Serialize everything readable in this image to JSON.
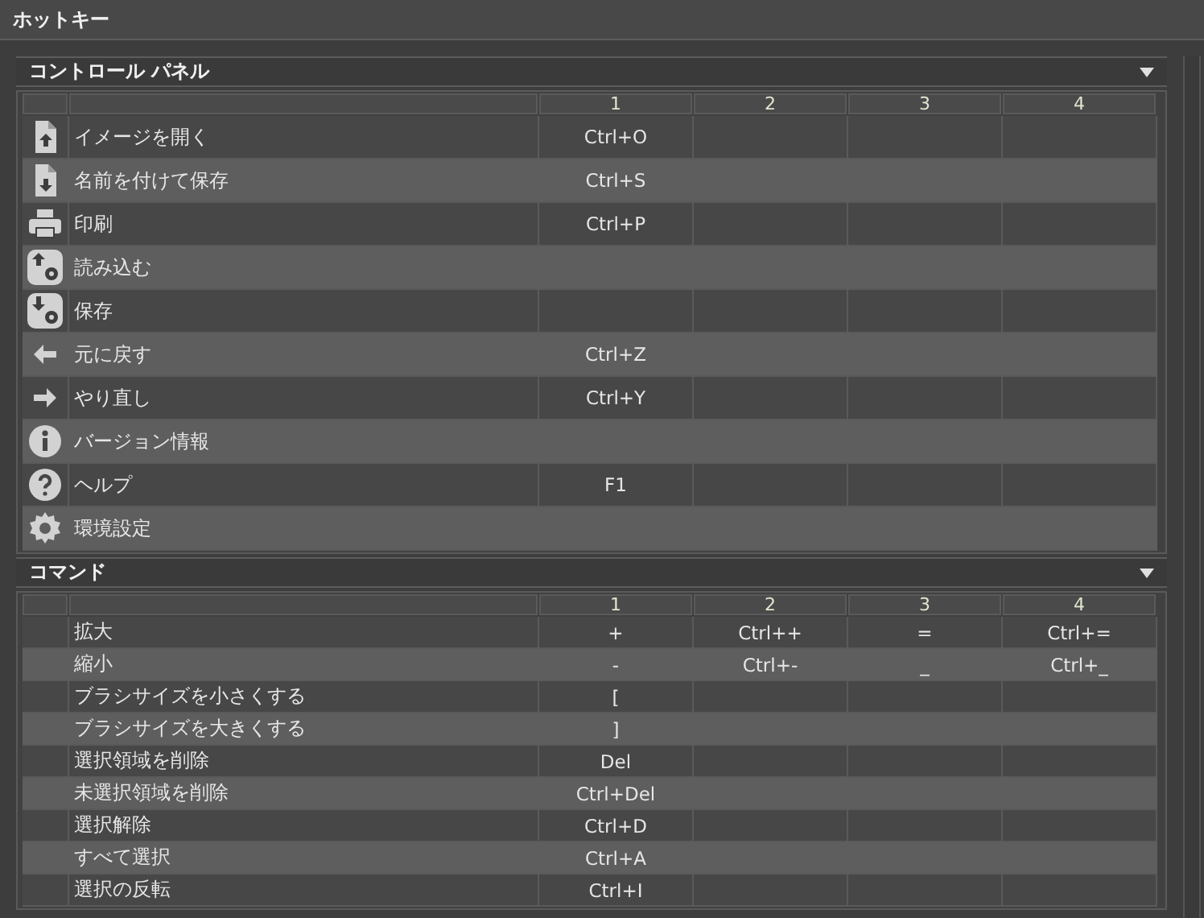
{
  "window": {
    "title": "ホットキー"
  },
  "sections": [
    {
      "title": "コントロール パネル",
      "expanded": true,
      "columns": [
        "1",
        "2",
        "3",
        "4"
      ],
      "rows": [
        {
          "kind": "file-up",
          "name": "イメージを開く",
          "keys": [
            "Ctrl+O"
          ]
        },
        {
          "kind": "file-down",
          "name": "名前を付けて保存",
          "keys": [
            "Ctrl+S"
          ]
        },
        {
          "kind": "printer",
          "name": "印刷",
          "keys": [
            "Ctrl+P"
          ]
        },
        {
          "kind": "up-gear",
          "name": "読み込む",
          "keys": []
        },
        {
          "kind": "down-gear",
          "name": "保存",
          "keys": []
        },
        {
          "kind": "arrow-left",
          "name": "元に戻す",
          "keys": [
            "Ctrl+Z"
          ]
        },
        {
          "kind": "arrow-right",
          "name": "やり直し",
          "keys": [
            "Ctrl+Y"
          ]
        },
        {
          "kind": "info",
          "name": "バージョン情報",
          "keys": []
        },
        {
          "kind": "question",
          "name": "ヘルプ",
          "keys": [
            "F1"
          ]
        },
        {
          "kind": "gear",
          "name": "環境設定",
          "keys": []
        }
      ]
    },
    {
      "title": "コマンド",
      "expanded": true,
      "columns": [
        "1",
        "2",
        "3",
        "4"
      ],
      "rows": [
        {
          "name": "拡大",
          "keys": [
            "+",
            "Ctrl++",
            "=",
            "Ctrl+="
          ]
        },
        {
          "name": "縮小",
          "keys": [
            "-",
            "Ctrl+-",
            "_",
            "Ctrl+_"
          ]
        },
        {
          "name": "ブラシサイズを小さくする",
          "keys": [
            "["
          ]
        },
        {
          "name": "ブラシサイズを大きくする",
          "keys": [
            "]"
          ]
        },
        {
          "name": "選択領域を削除",
          "keys": [
            "Del"
          ]
        },
        {
          "name": "未選択領域を削除",
          "keys": [
            "Ctrl+Del"
          ]
        },
        {
          "name": "選択解除",
          "keys": [
            "Ctrl+D"
          ]
        },
        {
          "name": "すべて選択",
          "keys": [
            "Ctrl+A"
          ]
        },
        {
          "name": "選択の反転",
          "keys": [
            "Ctrl+I"
          ]
        }
      ]
    }
  ]
}
